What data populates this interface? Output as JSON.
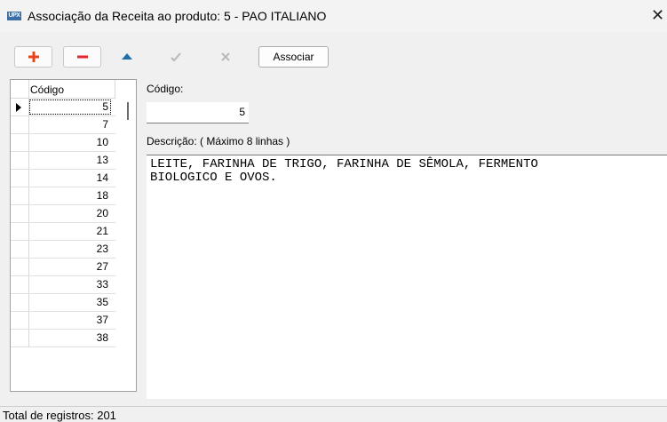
{
  "window": {
    "app_icon_text": "UPX",
    "title": "Associação da Receita ao produto: 5 - PAO ITALIANO",
    "close_glyph": "✕"
  },
  "toolbar": {
    "buttons": [
      {
        "name": "add",
        "icon": "plus-icon",
        "color": "#e8441c"
      },
      {
        "name": "remove",
        "icon": "minus-icon",
        "color": "#e8232b"
      },
      {
        "name": "up",
        "icon": "triangle-up-icon",
        "color": "#1f6fa8"
      },
      {
        "name": "confirm",
        "icon": "check-icon",
        "color": "#b8b8b8"
      },
      {
        "name": "cancel",
        "icon": "x-icon",
        "color": "#b8b8b8"
      }
    ],
    "associar_label": "Associar"
  },
  "grid": {
    "column_header": "Código",
    "rows": [
      "5",
      "7",
      "10",
      "13",
      "14",
      "18",
      "20",
      "21",
      "23",
      "27",
      "33",
      "35",
      "37",
      "38"
    ],
    "selected_index": 0
  },
  "form": {
    "code_label": "Código:",
    "code_value": "5",
    "desc_label": "Descrição: ( Máximo 8 linhas )",
    "desc_value": "LEITE, FARINHA DE TRIGO, FARINHA DE SÊMOLA, FERMENTO\nBIOLOGICO E OVOS."
  },
  "status": {
    "text": "Total de registros: 201"
  }
}
